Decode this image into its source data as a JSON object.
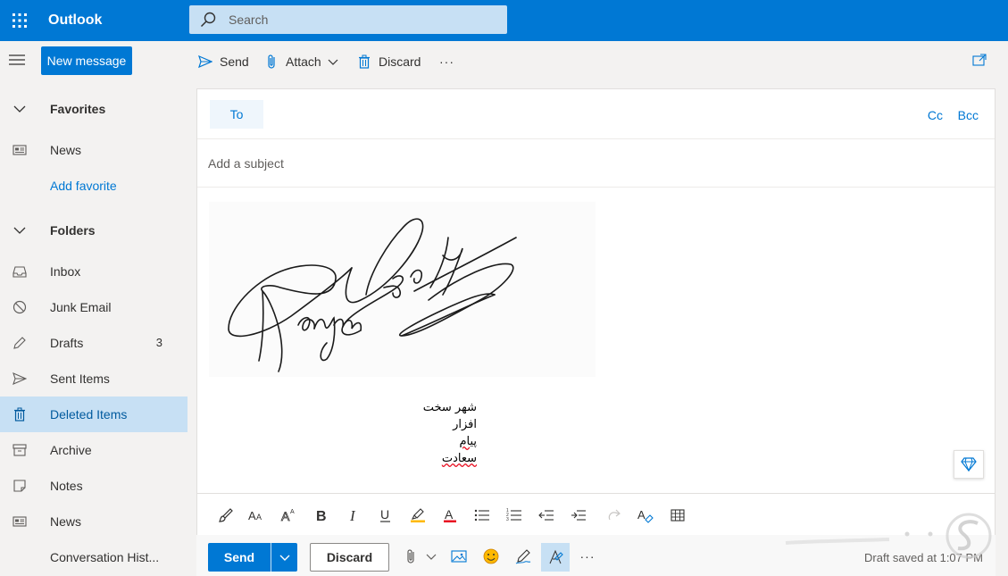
{
  "app": {
    "title": "Outlook"
  },
  "search": {
    "placeholder": "Search"
  },
  "nav": {
    "new_message": "New message",
    "items": [
      {
        "label": "Favorites",
        "kind": "header"
      },
      {
        "label": "News",
        "icon": "news-icon"
      },
      {
        "label": "Add favorite",
        "kind": "link"
      },
      {
        "label": "Folders",
        "kind": "header"
      },
      {
        "label": "Inbox",
        "icon": "inbox-icon"
      },
      {
        "label": "Junk Email",
        "icon": "junk-icon"
      },
      {
        "label": "Drafts",
        "icon": "drafts-icon",
        "count": "3"
      },
      {
        "label": "Sent Items",
        "icon": "sent-icon"
      },
      {
        "label": "Deleted Items",
        "icon": "trash-icon",
        "selected": true
      },
      {
        "label": "Archive",
        "icon": "archive-icon"
      },
      {
        "label": "Notes",
        "icon": "notes-icon"
      },
      {
        "label": "News",
        "icon": "news-icon"
      },
      {
        "label": "Conversation Hist...",
        "icon": ""
      }
    ]
  },
  "commandbar": {
    "send": "Send",
    "attach": "Attach",
    "discard": "Discard",
    "more": "···"
  },
  "compose": {
    "to_label": "To",
    "cc": "Cc",
    "bcc": "Bcc",
    "subject_placeholder": "Add a subject",
    "signature_lines": [
      "شهر سخت افزار",
      "پیام سعادت"
    ]
  },
  "actions": {
    "send": "Send",
    "discard": "Discard",
    "more": "···",
    "draft_status": "Draft saved at 1:07 PM"
  },
  "colors": {
    "accent": "#0078d4",
    "selected": "#c7e0f4"
  }
}
